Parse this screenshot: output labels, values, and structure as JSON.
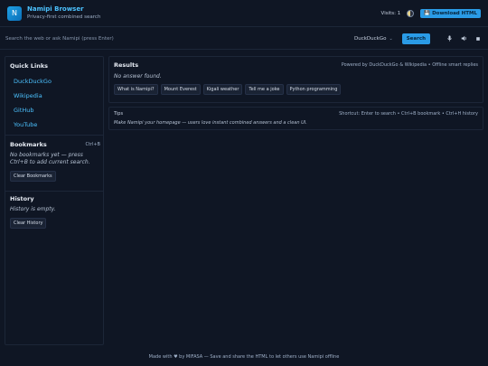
{
  "header": {
    "logo_letter": "N",
    "title": "Namipi Browser",
    "subtitle": "Privacy-first combined search",
    "visits": "Visits: 1",
    "download_label": "Download HTML"
  },
  "search": {
    "placeholder": "Search the web or ask Namipi (press Enter)",
    "engine": "DuckDuckGo",
    "button": "Search"
  },
  "sidebar": {
    "quick_links_title": "Quick Links",
    "quick_links": [
      "DuckDuckGo",
      "Wikipedia",
      "GitHub",
      "YouTube"
    ],
    "bookmarks_title": "Bookmarks",
    "bookmarks_shortcut": "Ctrl+B",
    "bookmarks_empty": "No bookmarks yet — press Ctrl+B to add current search.",
    "clear_bookmarks": "Clear Bookmarks",
    "history_title": "History",
    "history_empty": "History is empty.",
    "clear_history": "Clear History"
  },
  "results": {
    "title": "Results",
    "powered": "Powered by DuckDuckGo & Wikipedia • Offline smart replies",
    "no_answer": "No answer found.",
    "chips": [
      "What is Namipi?",
      "Mount Everest",
      "Kigali weather",
      "Tell me a joke",
      "Python programming"
    ]
  },
  "tips": {
    "label": "Tips",
    "shortcuts": "Shortcut: Enter to search • Ctrl+B bookmark • Ctrl+H history",
    "text": "Make Namipi your homepage — users love instant combined answers and a clean UI."
  },
  "footer": {
    "text": "Made with ♥ by MIFASA — Save and share the HTML to let others use Namipi offline"
  }
}
